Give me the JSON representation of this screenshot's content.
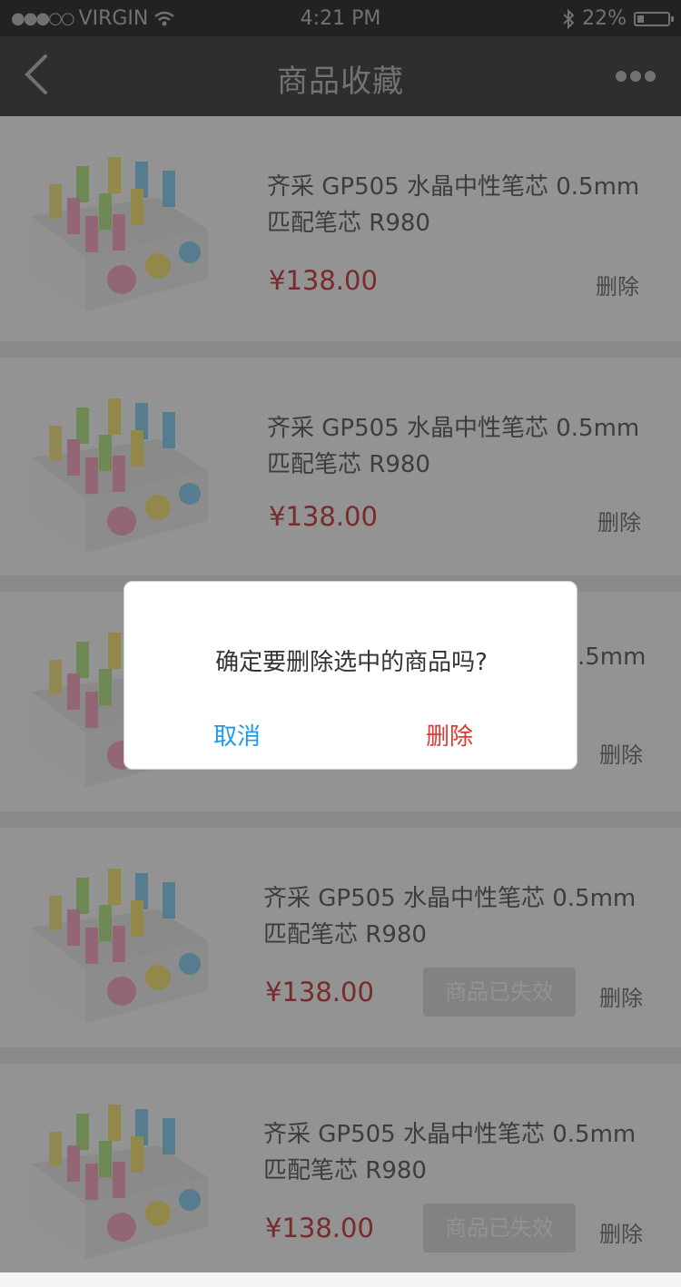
{
  "status_bar": {
    "carrier": "VIRGIN",
    "signal_dots": "●●●○○",
    "time": "4:21 PM",
    "battery_text": "22%",
    "battery_level": 0.22
  },
  "nav": {
    "title": "商品收藏",
    "back_icon": "chevron-left-icon",
    "more_icon": "more-dots-icon"
  },
  "products": [
    {
      "name": "齐采 GP505  水晶中性笔芯 0.5mm 匹配笔芯 R980",
      "price": "¥138.00",
      "delete_label": "删除",
      "status": ""
    },
    {
      "name": "齐采 GP505  水晶中性笔芯 0.5mm 匹配笔芯 R980",
      "price": "¥138.00",
      "delete_label": "删除",
      "status": ""
    },
    {
      "name": ".5mm",
      "price": "",
      "delete_label": "删除",
      "status": ""
    },
    {
      "name": "齐采 GP505  水晶中性笔芯 0.5mm 匹配笔芯 R980",
      "price": "¥138.00",
      "delete_label": "删除",
      "status": "商品已失效"
    },
    {
      "name": "齐采 GP505  水晶中性笔芯 0.5mm 匹配笔芯 R980",
      "price": "¥138.00",
      "delete_label": "删除",
      "status": "商品已失效"
    }
  ],
  "dialog": {
    "message": "确定要删除选中的商品吗?",
    "cancel_label": "取消",
    "confirm_label": "删除"
  },
  "colors": {
    "price": "#c8464a",
    "cancel": "#1e9be8",
    "confirm": "#e5362f"
  }
}
